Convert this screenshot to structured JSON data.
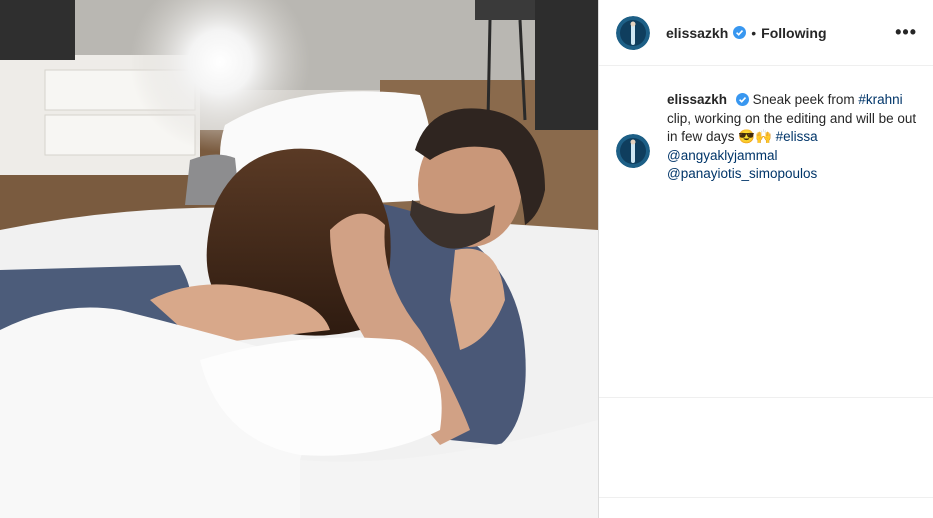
{
  "post": {
    "username": "elissazkh",
    "follow_status": "Following",
    "separator": "•",
    "more_label": "•••",
    "caption": {
      "username": "elissazkh",
      "text_pre": "Sneak peek from ",
      "hashtag1": "#krahni",
      "text_mid": " clip, working on the editing and will be out in few days 😎🙌 ",
      "hashtag2": "#elissa",
      "mention1": "@angyaklyjammal",
      "mention2": "@panayiotis_simopoulos"
    }
  },
  "colors": {
    "link": "#003569",
    "verified": "#3897f0",
    "divider": "#efefef"
  }
}
